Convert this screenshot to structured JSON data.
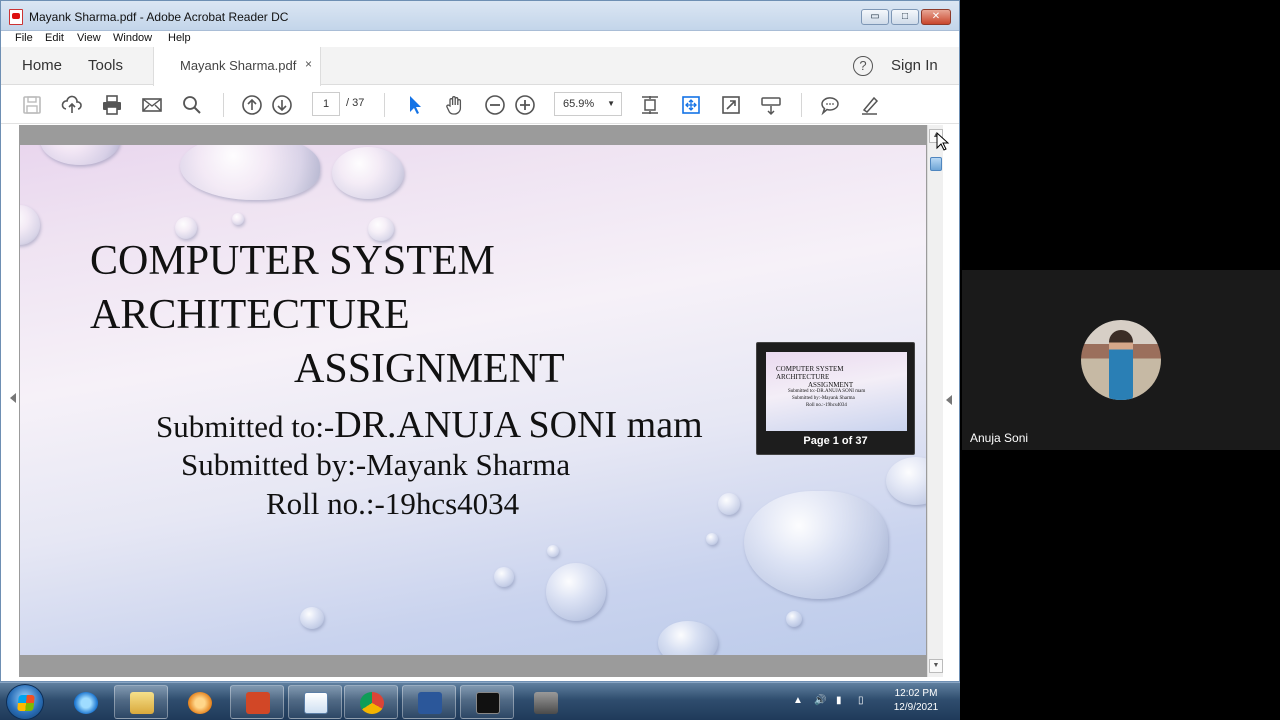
{
  "window": {
    "title": "Mayank Sharma.pdf - Adobe Acrobat Reader DC",
    "buttons": {
      "minimize": "▭",
      "maximize": "□",
      "close": "✕"
    }
  },
  "menu": [
    "File",
    "Edit",
    "View",
    "Window",
    "Help"
  ],
  "tabs": {
    "home": "Home",
    "tools": "Tools",
    "document": "Mayank Sharma.pdf",
    "close_glyph": "×",
    "help_glyph": "?",
    "sign_in": "Sign In"
  },
  "toolbar": {
    "current_page": "1",
    "page_total": "/ 37",
    "zoom": "65.9%",
    "zoom_arrow": "▼"
  },
  "slide": {
    "line1": "COMPUTER SYSTEM",
    "line2": "ARCHITECTURE",
    "line3": "ASSIGNMENT",
    "submitted_to_label": "Submitted to:-",
    "submitted_to_name": "DR.ANUJA SONI mam",
    "submitted_by": "Submitted by:-Mayank Sharma",
    "roll_no": "Roll no.:-19hcs4034"
  },
  "thumbnail": {
    "lines": [
      "COMPUTER SYSTEM",
      "ARCHITECTURE",
      "ASSIGNMENT",
      "Submitted to:-DR.ANUJA SONI mam",
      "Submitted by:-Mayank Sharma",
      "Roll no.:-19hcs4034"
    ],
    "label": "Page 1 of 37"
  },
  "scrollbar": {
    "up": "▲",
    "down": "▼"
  },
  "taskbar": {
    "time": "12:02 PM",
    "date": "12/9/2021",
    "items": [
      "start-orb",
      "internet-explorer-icon",
      "file-explorer-icon",
      "media-player-icon",
      "powerpoint-icon",
      "notepad-icon",
      "chrome-icon",
      "word-icon",
      "command-prompt-icon",
      "cpu-sim-icon"
    ]
  },
  "participant": {
    "name": "Anuja Soni"
  },
  "colors": {
    "accent_blue": "#1473e6",
    "taskbar": "#2f4d6e",
    "slide_top": "#e9d6ee",
    "slide_bottom": "#bccbea"
  }
}
